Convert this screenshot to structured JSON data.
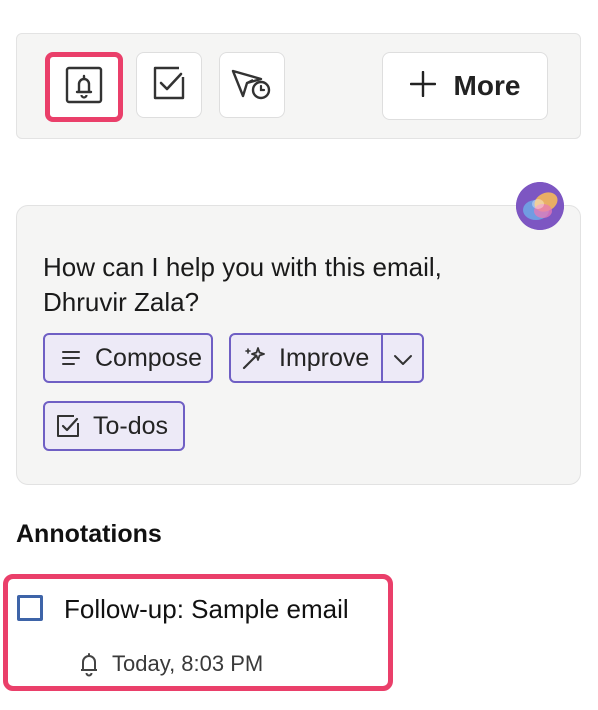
{
  "toolbar": {
    "buttons": [
      {
        "icon": "reminder-bell-icon",
        "selected": true
      },
      {
        "icon": "task-checkbox-icon",
        "selected": false
      },
      {
        "icon": "scheduled-send-icon",
        "selected": false
      }
    ],
    "more_icon": "plus-icon",
    "more_label": "More"
  },
  "copilot": {
    "avatar_icon": "copilot-avatar-icon",
    "question_line1": "How can I help you with this email,",
    "question_line2": "Dhruvir Zala?",
    "chips": {
      "compose": {
        "icon": "lines-icon",
        "label": "Compose"
      },
      "improve": {
        "icon": "magic-wand-icon",
        "label": "Improve",
        "dropdown_icon": "chevron-down-icon"
      },
      "todos": {
        "icon": "checkbox-icon",
        "label": "To-dos"
      }
    }
  },
  "annotations": {
    "title": "Annotations",
    "items": [
      {
        "text": "Follow-up: Sample email",
        "reminder_icon": "bell-icon",
        "time": "Today, 8:03 PM",
        "checked": false
      }
    ]
  },
  "colors": {
    "highlight": "#ea3f6a",
    "chip_border": "#6f5fc4",
    "chip_fill": "#edeaf7",
    "checkbox_border": "#3e64a8",
    "panel_bg": "#f5f5f4"
  }
}
